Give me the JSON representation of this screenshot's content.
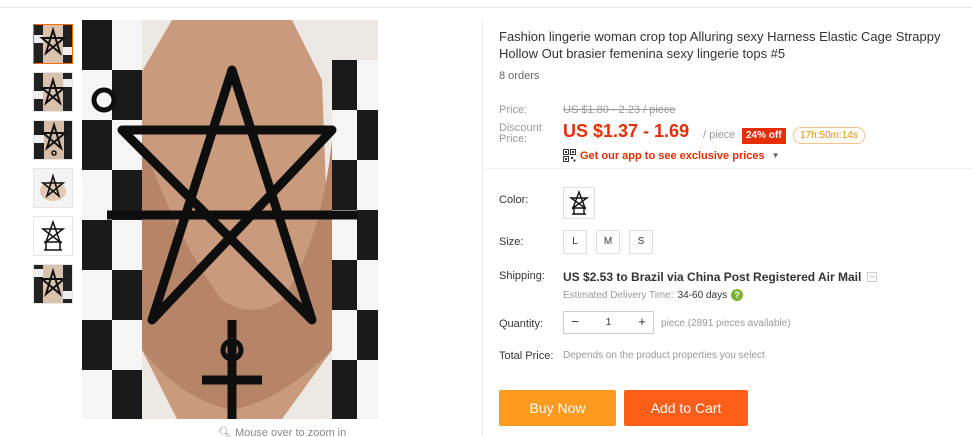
{
  "gallery": {
    "thumbnail_count": 6,
    "active_index": 0,
    "zoom_hint": "Mouse over to zoom in"
  },
  "product": {
    "title": "Fashion lingerie woman crop top Alluring sexy Harness Elastic Cage Strappy Hollow Out brasier femenina sexy lingerie tops #5",
    "orders": "8 orders"
  },
  "pricing": {
    "price_label": "Price:",
    "original_price": "US $1.80 - 2.23 / piece",
    "discount_label": "Discount Price:",
    "discount_price": "US $1.37 - 1.69",
    "unit": "/ piece",
    "off_badge": "24% off",
    "countdown": "17h:50m:14s",
    "app_promo": "Get our app to see exclusive prices",
    "accent_color": "#e62e04"
  },
  "sku": {
    "color_label": "Color:",
    "size_label": "Size:",
    "sizes": [
      "L",
      "M",
      "S"
    ]
  },
  "shipping": {
    "label": "Shipping:",
    "text": "US $2.53 to Brazil via China Post Registered Air Mail",
    "est_label": "Estimated Delivery Time:",
    "est_days": "34-60 days",
    "help_icon": "?"
  },
  "quantity": {
    "label": "Quantity:",
    "minus": "−",
    "value": "1",
    "plus": "+",
    "note": "piece (2891 pieces available)"
  },
  "total": {
    "label": "Total Price:",
    "note": "Depends on the product properties you select"
  },
  "actions": {
    "buy_now": "Buy Now",
    "add_to_cart": "Add to Cart",
    "buy_color": "#ff9a1e",
    "cart_color": "#ff5e18"
  }
}
